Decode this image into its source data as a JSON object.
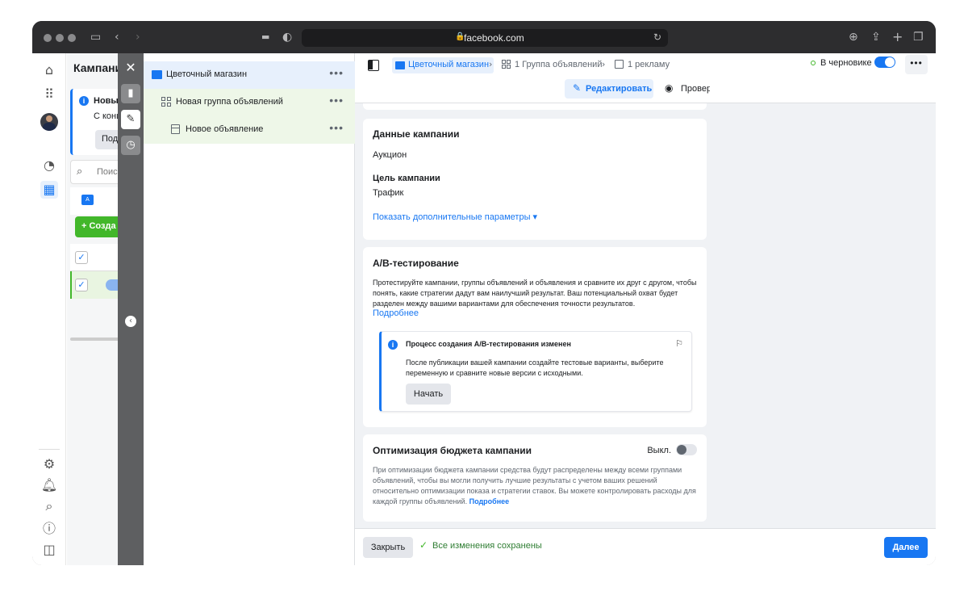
{
  "browser": {
    "url": "facebook.com"
  },
  "sidebar_campaigns": {
    "title": "Кампании",
    "notice_title": "Новый",
    "notice_text": "С конц",
    "notice_button": "Под",
    "search_placeholder": "Поиск",
    "folder_badge": "A",
    "create_button": "Созда"
  },
  "tree": {
    "campaign": "Цветочный магазин",
    "adset": "Новая группа объявлений",
    "ad": "Новое объявление",
    "more": "•••"
  },
  "breadcrumb": {
    "campaign": "Цветочный магазин",
    "adset": "1 Группа объявлений",
    "ad": "1 рекламу",
    "separator": "›"
  },
  "status": {
    "draft_label": "В черновике",
    "draft_toggle_on": true,
    "more": "•••"
  },
  "modes": {
    "edit": "Редактировать",
    "review": "Проверка"
  },
  "campaign_data": {
    "heading": "Данные кампании",
    "buying_type": "Аукцион",
    "objective_label": "Цель кампании",
    "objective_value": "Трафик",
    "more_options": "Показать дополнительные параметры ▾"
  },
  "ab_test": {
    "heading": "A/B-тестирование",
    "description": "Протестируйте кампании, группы объявлений и объявления и сравните их друг с другом, чтобы понять, какие стратегии дадут вам наилучший результат. Ваш потенциальный охват будет разделен между вашими вариантами для обеспечения точности результатов.",
    "learn_more": "Подробнее",
    "notice_title": "Процесс создания A/B-тестирования изменен",
    "notice_text": "После публикации вашей кампании создайте тестовые варианты, выберите переменную и сравните новые версии с исходными.",
    "start_button": "Начать"
  },
  "budget_opt": {
    "heading": "Оптимизация бюджета кампании",
    "toggle_label": "Выкл.",
    "description": "При оптимизации бюджета кампании средства будут распределены между всеми группами объявлений, чтобы вы могли получить лучшие результаты с учетом ваших решений относительно оптимизации показа и стратегии ставок. Вы можете контролировать расходы для каждой группы объявлений.",
    "learn_more": "Подробнее"
  },
  "footer": {
    "close_button": "Закрыть",
    "saved_text": "Все изменения сохранены",
    "next_button": "Далее"
  },
  "colors": {
    "accent": "#1877f2",
    "success": "#42b72a",
    "tree_campaign_bg": "#e7f0fc",
    "tree_child_bg": "#eef7e8"
  }
}
